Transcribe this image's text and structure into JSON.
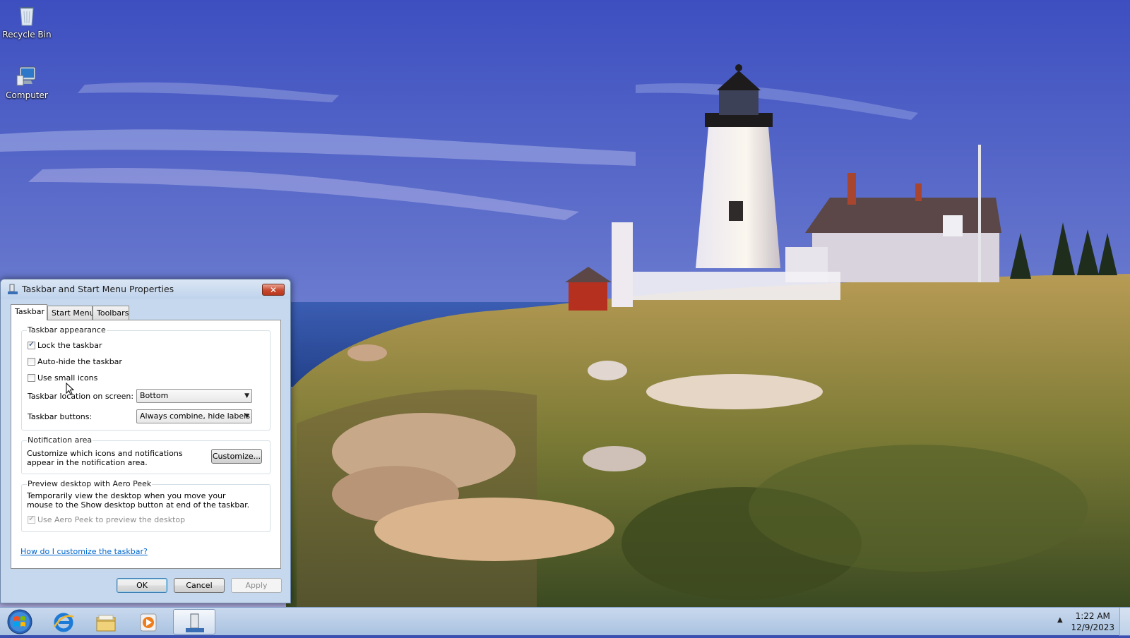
{
  "desktop": {
    "icons": [
      {
        "label": "Recycle Bin",
        "icon": "recycle-bin-icon"
      },
      {
        "label": "Computer",
        "icon": "computer-icon"
      }
    ]
  },
  "dialog": {
    "title": "Taskbar and Start Menu Properties",
    "close_label": "✕",
    "tabs": [
      "Taskbar",
      "Start Menu",
      "Toolbars"
    ],
    "active_tab": "Taskbar",
    "appearance": {
      "label": "Taskbar appearance",
      "lock_label": "Lock the taskbar",
      "lock_checked": true,
      "autohide_label": "Auto-hide the taskbar",
      "autohide_checked": false,
      "small_icons_label": "Use small icons",
      "small_icons_checked": false,
      "location_label": "Taskbar location on screen:",
      "location_value": "Bottom",
      "buttons_label": "Taskbar buttons:",
      "buttons_value": "Always combine, hide labels"
    },
    "notification": {
      "label": "Notification area",
      "text": "Customize which icons and notifications appear in the notification area.",
      "customize_label": "Customize..."
    },
    "aero_peek": {
      "label": "Preview desktop with Aero Peek",
      "text": "Temporarily view the desktop when you move your mouse to the Show desktop button at end of the taskbar.",
      "checkbox_label": "Use Aero Peek to preview the desktop",
      "checked": true,
      "enabled": false
    },
    "help_link": "How do I customize the taskbar?",
    "buttons": {
      "ok": "OK",
      "cancel": "Cancel",
      "apply": "Apply"
    }
  },
  "taskbar": {
    "items": [
      "start-orb-icon",
      "internet-explorer-icon",
      "file-explorer-icon",
      "media-player-icon",
      "taskbar-properties-icon"
    ],
    "clock": {
      "time": "1:22 AM",
      "date": "12/9/2023"
    },
    "tray_arrow": "▲"
  },
  "colors": {
    "sky": "#4a5fc4",
    "sea": "#2f4f9e",
    "grass": "#8f8a3a",
    "taskbar": "#b9cde7",
    "dialog_frame": "#c6d8ee"
  }
}
